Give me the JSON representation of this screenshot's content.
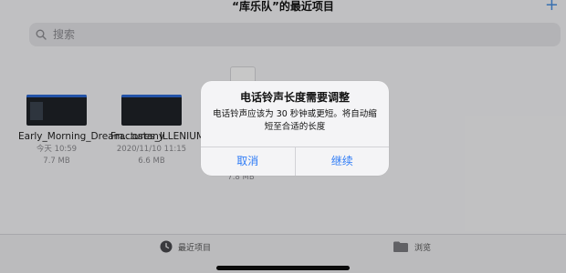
{
  "nav": {
    "title": "“库乐队”的最近项目",
    "add_icon": "plus-icon"
  },
  "search": {
    "placeholder": "搜索",
    "icon": "search-icon"
  },
  "files": [
    {
      "name": "Early_Morning_Dream...ostany",
      "date": "今天 10:59",
      "size": "7.7 MB"
    },
    {
      "name": "Fractures_ILLENIUM_Nevve",
      "date": "2020/11/10 11:15",
      "size": "6.6 MB"
    },
    {
      "name": "",
      "date": "",
      "size": "7.8 MB"
    }
  ],
  "alert": {
    "title": "电话铃声长度需要调整",
    "message": "电话铃声应该为 30 秒钟或更短。将自动缩短至合适的长度",
    "cancel": "取消",
    "continue": "继续"
  },
  "tabbar": {
    "recent": {
      "label": "最近项目",
      "icon": "clock-icon"
    },
    "browse": {
      "label": "浏览",
      "icon": "folder-icon"
    }
  },
  "colors": {
    "accent": "#2f7cf6",
    "overlay": "rgba(0,0,0,0.22)"
  }
}
